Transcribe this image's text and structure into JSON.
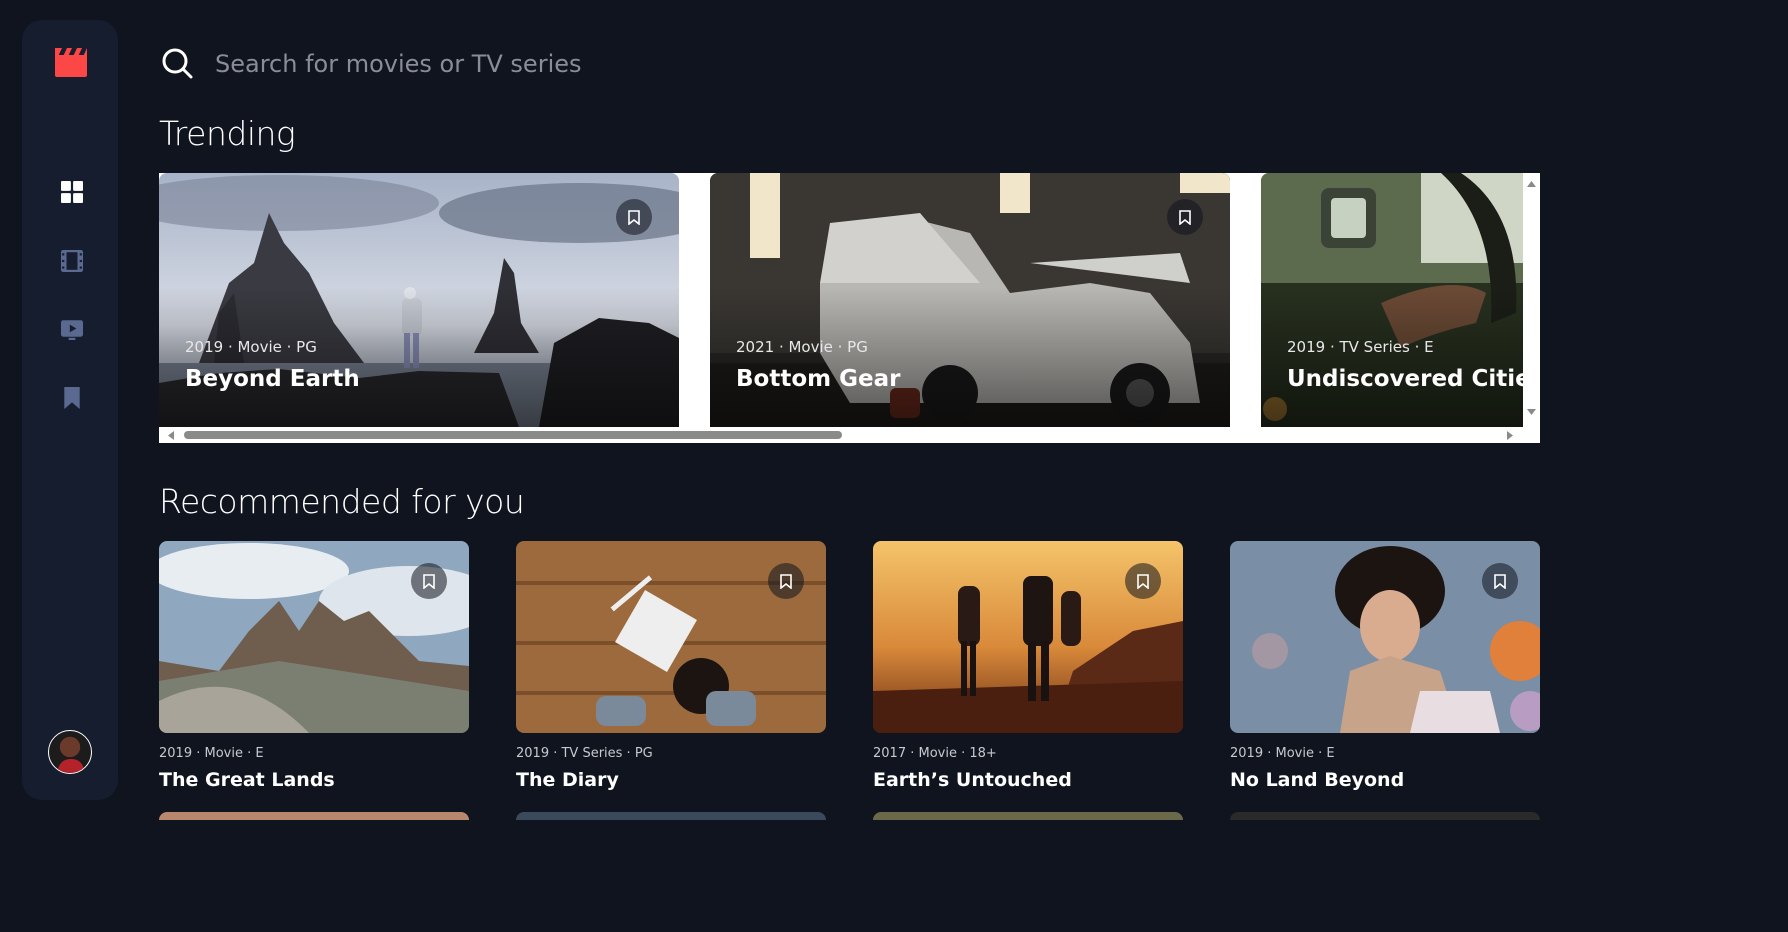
{
  "colors": {
    "background": "#10141e",
    "sidebar": "#161d2f",
    "accent": "#fc4747",
    "nav_icon": "#5a698f",
    "nav_active": "#ffffff"
  },
  "sidebar": {
    "logo_icon": "clapperboard-icon",
    "nav": [
      {
        "icon": "grid-icon",
        "active": true
      },
      {
        "icon": "film-icon",
        "active": false
      },
      {
        "icon": "tv-icon",
        "active": false
      },
      {
        "icon": "bookmark-icon",
        "active": false
      }
    ],
    "avatar_icon": "avatar"
  },
  "search": {
    "placeholder": "Search for movies or TV series",
    "value": ""
  },
  "trending": {
    "heading": "Trending",
    "items": [
      {
        "meta": "2019 · Movie · PG",
        "title": "Beyond Earth"
      },
      {
        "meta": "2021 · Movie · PG",
        "title": "Bottom Gear"
      },
      {
        "meta": "2019 · TV Series · E",
        "title": "Undiscovered Cities"
      }
    ]
  },
  "recommended": {
    "heading": "Recommended for you",
    "items": [
      {
        "meta": "2019 · Movie · E",
        "title": "The Great Lands"
      },
      {
        "meta": "2019 · TV Series · PG",
        "title": "The Diary"
      },
      {
        "meta": "2017 · Movie · 18+",
        "title": "Earth’s Untouched"
      },
      {
        "meta": "2019 · Movie · E",
        "title": "No Land Beyond"
      }
    ]
  }
}
